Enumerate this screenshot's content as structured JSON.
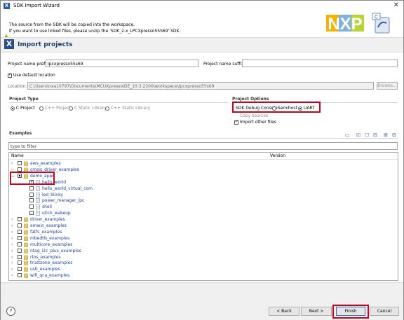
{
  "window": {
    "title": "SDK Import Wizard",
    "close": "✕"
  },
  "banner": {
    "line1": "The source from the SDK will be copied into the workspace.",
    "line2": "If you want to use linked files, please unzip the 'SDK_2.x_LPCXpresso55S69' SDK.",
    "logo_text": "NXP"
  },
  "page": {
    "title": "Import projects"
  },
  "form": {
    "prefix_label": "Project name prefix:",
    "prefix_value": "lpcxpresso55s69",
    "suffix_label": "Project name suffix:",
    "suffix_value": "",
    "use_default_label": "Use default location",
    "location_label": "Location:",
    "location_value": "C:\\Users\\nxa10797\\Documents\\MCUXpressoIDE_10.3.2200\\workspace\\lpcxpresso55s69",
    "browse_label": "Browse..."
  },
  "project_type": {
    "title": "Project Type",
    "options": [
      "C Project",
      "C++ Project",
      "C Static Library",
      "C++ Static Library"
    ],
    "selected": "C Project"
  },
  "project_options": {
    "title": "Project Options",
    "debug_console_label": "SDK Debug Console",
    "semihost_label": "Semihost",
    "uart_label": "UART",
    "selected": "UART",
    "copy_sources_label": "Copy sources",
    "import_other_label": "Import other files"
  },
  "examples": {
    "title": "Examples",
    "filter_placeholder": "type to filter",
    "col_name": "Name",
    "col_version": "Version",
    "rows": [
      {
        "label": "aws_examples",
        "expanded": false,
        "checked": false
      },
      {
        "label": "cmsis_driver_examples",
        "expanded": false,
        "checked": false
      },
      {
        "label": "demo_apps",
        "expanded": true,
        "checked": "partial"
      },
      {
        "label": "hello_world",
        "child": true,
        "checked": true
      },
      {
        "label": "hello_world_virtual_com",
        "child": true,
        "checked": false
      },
      {
        "label": "led_blinky",
        "child": true,
        "checked": false
      },
      {
        "label": "power_manager_lpc",
        "child": true,
        "checked": false
      },
      {
        "label": "shell",
        "child": true,
        "checked": false
      },
      {
        "label": "utick_wakeup",
        "child": true,
        "checked": false
      },
      {
        "label": "driver_examples",
        "expanded": false,
        "checked": false
      },
      {
        "label": "emwin_examples",
        "expanded": false,
        "checked": false
      },
      {
        "label": "fatfs_examples",
        "expanded": false,
        "checked": false
      },
      {
        "label": "mbedtls_examples",
        "expanded": false,
        "checked": false
      },
      {
        "label": "multicore_examples",
        "expanded": false,
        "checked": false
      },
      {
        "label": "ntag_i2c_plus_examples",
        "expanded": false,
        "checked": false
      },
      {
        "label": "rtos_examples",
        "expanded": false,
        "checked": false
      },
      {
        "label": "trustzone_examples",
        "expanded": false,
        "checked": false
      },
      {
        "label": "usb_examples",
        "expanded": false,
        "checked": false
      },
      {
        "label": "wifi_qca_examples",
        "expanded": false,
        "checked": false
      }
    ]
  },
  "footer": {
    "help": "?",
    "back": "< Back",
    "next": "Next >",
    "finish": "Finish",
    "cancel": "Cancel"
  },
  "colors": {
    "highlight": "#d0021b",
    "link": "#1a3f9e"
  }
}
